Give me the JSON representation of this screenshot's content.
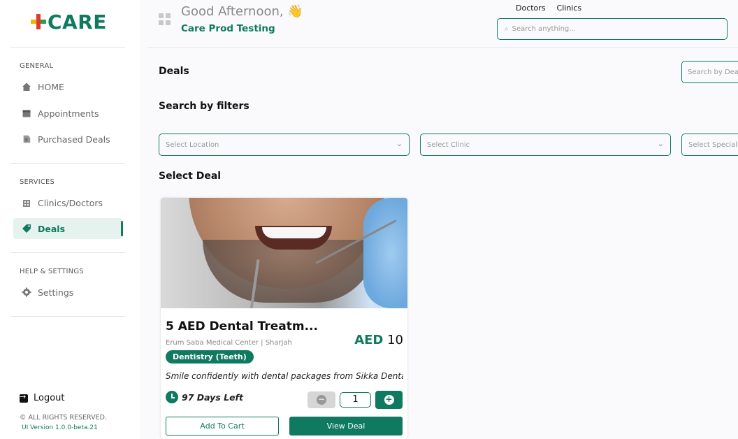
{
  "brand": {
    "name": "CARE",
    "primary_color": "#0f7a5f"
  },
  "sidebar": {
    "general_label": "GENERAL",
    "services_label": "SERVICES",
    "help_label": "HELP & SETTINGS",
    "items": [
      {
        "label": "HOME",
        "icon": "home-icon"
      },
      {
        "label": "Appointments",
        "icon": "calendar-icon"
      },
      {
        "label": "Purchased Deals",
        "icon": "purchased-deals-icon"
      },
      {
        "label": "Clinics/Doctors",
        "icon": "building-icon"
      },
      {
        "label": "Deals",
        "icon": "tag-icon",
        "active": true
      },
      {
        "label": "Settings",
        "icon": "gear-icon"
      }
    ],
    "logout": "Logout",
    "rights": "© ALL RIGHTS RESERVED.",
    "version": "UI Version 1.0.0-beta.21"
  },
  "header": {
    "greeting": "Good Afternoon, 👋",
    "subtitle": "Care Prod Testing",
    "links": [
      "Doctors",
      "Clinics"
    ],
    "search_placeholder": "Search anything..."
  },
  "main": {
    "deals_heading": "Deals",
    "deal_search_placeholder": "Search by Deal",
    "filters_heading": "Search by filters",
    "filters": [
      "Select Location",
      "Select Clinic",
      "Select Specialization"
    ],
    "select_deal_heading": "Select Deal"
  },
  "deal_card": {
    "title": "5 AED Dental Treatm...",
    "price_currency": "AED",
    "price_value": "10",
    "clinic": "Erum Saba Medical Center | Sharjah",
    "tag": "Dentistry (Teeth)",
    "description": "Smile confidently with dental packages from Sikka Dental",
    "days_left": "97 Days Left",
    "quantity": "1",
    "add_to_cart": "Add To Cart",
    "view_deal": "View Deal"
  }
}
